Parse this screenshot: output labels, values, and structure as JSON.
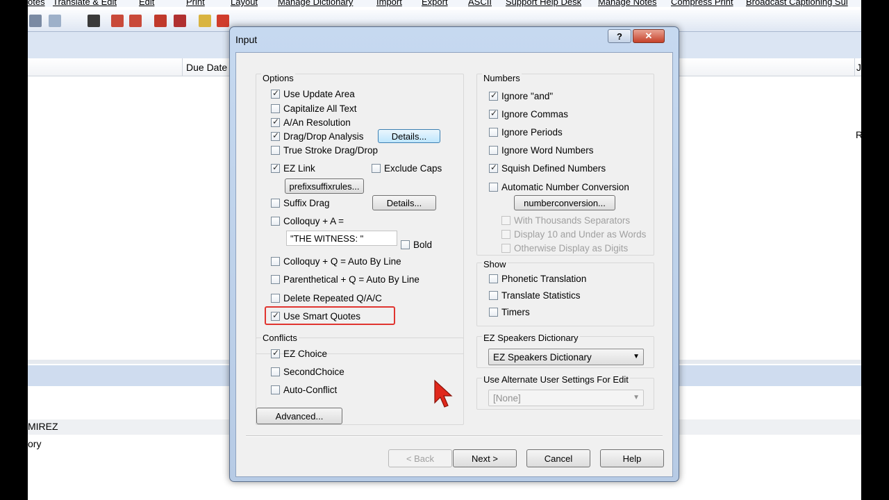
{
  "background_app": {
    "menu": [
      "otes",
      "Translate & Edit",
      "Edit",
      "Print",
      "Layout",
      "Manage Dictionary",
      "Import",
      "Export",
      "ASCII",
      "Support Help Desk",
      "Manage Notes",
      "Compress Print",
      "Broadcast Captioning Sui"
    ],
    "column_header": "Due Date",
    "column_header_edge": "J",
    "right_edge_text": "R",
    "list_text_1": "MIREZ",
    "list_text_2": "ory"
  },
  "dialog": {
    "title": "Input",
    "help_symbol": "?",
    "close_symbol": "✕",
    "options": {
      "label": "Options",
      "use_update_area": "Use Update Area",
      "capitalize_all_text": "Capitalize All Text",
      "a_an_resolution": "A/An Resolution",
      "drag_drop_analysis": "Drag/Drop Analysis",
      "details_1": "Details...",
      "true_stroke": "True Stroke Drag/Drop",
      "ez_link": "EZ Link",
      "exclude_caps": "Exclude Caps",
      "prefixsuffixrules": "prefixsuffixrules...",
      "suffix_drag": "Suffix Drag",
      "details_2": "Details...",
      "colloquy_a": "Colloquy + A =",
      "witness_value": "\"THE WITNESS: \"",
      "bold": "Bold",
      "colloquy_q": "Colloquy + Q =  Auto By Line",
      "parenthetical_q": "Parenthetical + Q =  Auto By Line",
      "delete_repeated": "Delete Repeated Q/A/C",
      "use_smart_quotes": "Use Smart Quotes"
    },
    "conflicts": {
      "label": "Conflicts",
      "ez_choice": "EZ Choice",
      "second_choice": "SecondChoice",
      "auto_conflict": "Auto-Conflict"
    },
    "advanced": "Advanced...",
    "numbers": {
      "label": "Numbers",
      "ignore_and": "Ignore \"and\"",
      "ignore_commas": "Ignore Commas",
      "ignore_periods": "Ignore Periods",
      "ignore_word_numbers": "Ignore Word Numbers",
      "squish_defined": "Squish Defined Numbers",
      "automatic_conversion": "Automatic Number Conversion",
      "numberconversion": "numberconversion...",
      "with_thousands": "With Thousands Separators",
      "display_10": "Display 10 and Under as Words",
      "otherwise_digits": "Otherwise Display as Digits"
    },
    "show": {
      "label": "Show",
      "phonetic": "Phonetic Translation",
      "translate_stats": "Translate Statistics",
      "timers": "Timers"
    },
    "ez_speakers": {
      "label": "EZ Speakers Dictionary",
      "value": "EZ Speakers Dictionary"
    },
    "alternate_user": {
      "label": "Use Alternate User Settings For Edit",
      "value": "[None]"
    },
    "footer": {
      "back": "< Back",
      "next": "Next >",
      "cancel": "Cancel",
      "help": "Help"
    }
  },
  "colors": {
    "highlight": "#e0342f",
    "cursor": "#e0281c"
  }
}
